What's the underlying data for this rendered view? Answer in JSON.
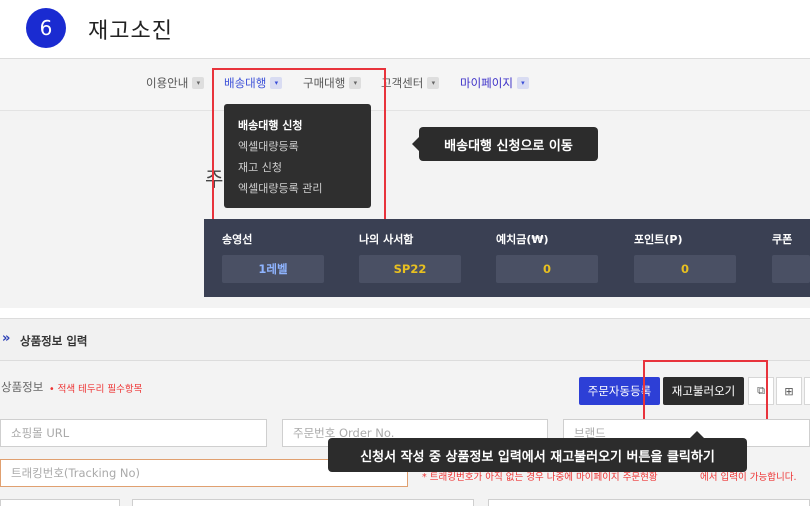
{
  "step": {
    "number": "6",
    "title": "재고소진"
  },
  "nav": {
    "items": [
      {
        "label": "이용안내",
        "caret": "▾"
      },
      {
        "label": "배송대행",
        "caret": "▾"
      },
      {
        "label": "구매대행",
        "caret": "▾"
      },
      {
        "label": "고객센터",
        "caret": "▾"
      },
      {
        "label": "마이페이지",
        "caret": "▾"
      }
    ],
    "dropdown": [
      "배송대행 신청",
      "엑셀대량등록",
      "재고 신청",
      "엑셀대량등록 관리"
    ]
  },
  "tooltip1": "배송대행 신청으로 이동",
  "partial_char": "주",
  "stats": [
    {
      "label": "송영선",
      "value": "1레벨"
    },
    {
      "label": "나의 사서함",
      "value": "SP22"
    },
    {
      "label": "예치금(₩)",
      "value": "0"
    },
    {
      "label": "포인트(P)",
      "value": "0"
    },
    {
      "label": "쿠폰",
      "value": ""
    }
  ],
  "section": {
    "chevron": "»",
    "title": "상품정보 입력"
  },
  "product_info": {
    "label": "상품정보",
    "note": "• 적색 테두리 필수항목"
  },
  "buttons": {
    "auto_register": "주문자동등록",
    "load_stock": "재고불러오기",
    "icon1": "⧉",
    "icon2": "⊞",
    "icon3": ""
  },
  "fields": {
    "mall_url": "쇼핑몰 URL",
    "order_no": "주문번호 Order No.",
    "brand": "브랜드",
    "tracking": "트래킹번호(Tracking No)"
  },
  "warning": {
    "left": "* 트래킹번호가 아직 없는 경우 나중에 마이페이지 주문현황",
    "right": "에서 입력이 가능합니다."
  },
  "tooltip2": "신청서 작성 중 상품정보 입력에서 재고불러오기 버튼을 클릭하기",
  "colors": {
    "accent": "#1a2bd1",
    "highlight": "#e8333c",
    "tooltip": "#2c2c2c"
  }
}
